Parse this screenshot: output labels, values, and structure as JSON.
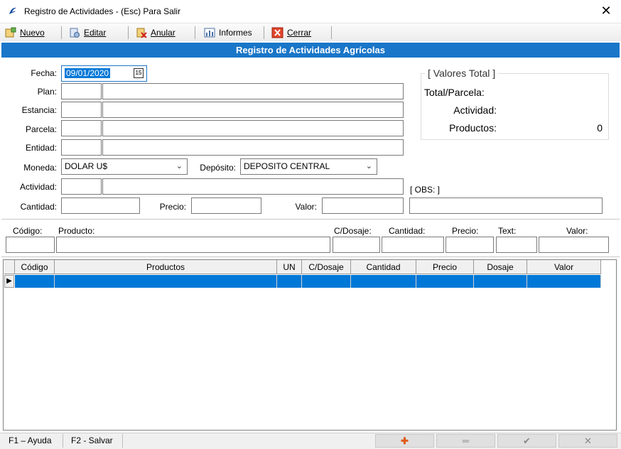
{
  "window": {
    "title": "Registro de Actividades  -  (Esc) Para Salir",
    "close": "✕"
  },
  "toolbar": {
    "nuevo": "Nuevo",
    "editar": "Editar",
    "anular": "Anular",
    "informes": "Informes",
    "cerrar": "Cerrar"
  },
  "header": {
    "title": "Registro de Actividades Agrícolas"
  },
  "form": {
    "fecha_label": "Fecha:",
    "fecha_value": "09/01/2020",
    "cal_icon": "15",
    "plan_label": "Plan:",
    "estancia_label": "Estancia:",
    "parcela_label": "Parcela:",
    "entidad_label": "Entidad:",
    "moneda_label": "Moneda:",
    "moneda_value": "DOLAR U$",
    "deposito_label": "Depósito:",
    "deposito_value": "DEPOSITO CENTRAL",
    "actividad_label": "Actividad:",
    "cantidad_label": "Cantidad:",
    "precio_label": "Precio:",
    "valor_label": "Valor:",
    "obs_label": "[ OBS: ]"
  },
  "totals": {
    "title": "[ Valores Total ]",
    "total_parcela_label": "Total/Parcela:",
    "actividad_label": "Actividad:",
    "productos_label": "Productos:",
    "productos_value": "0"
  },
  "product_entry": {
    "codigo": "Código:",
    "producto": "Producto:",
    "c_dosaje": "C/Dosaje:",
    "cantidad": "Cantidad:",
    "precio": "Precio:",
    "text": "Text:",
    "valor": "Valor:"
  },
  "grid": {
    "columns": [
      "Código",
      "Productos",
      "UN",
      "C/Dosaje",
      "Cantidad",
      "Precio",
      "Dosaje",
      "Valor"
    ],
    "row_indicator": "▶"
  },
  "statusbar": {
    "help": "F1 – Ayuda",
    "save": "F2 - Salvar",
    "add_icon": "✚",
    "remove_icon": "═",
    "confirm_icon": "✔",
    "cancel_icon": "✕"
  },
  "colors": {
    "accent": "#1976c8",
    "selection": "#0078d7"
  }
}
